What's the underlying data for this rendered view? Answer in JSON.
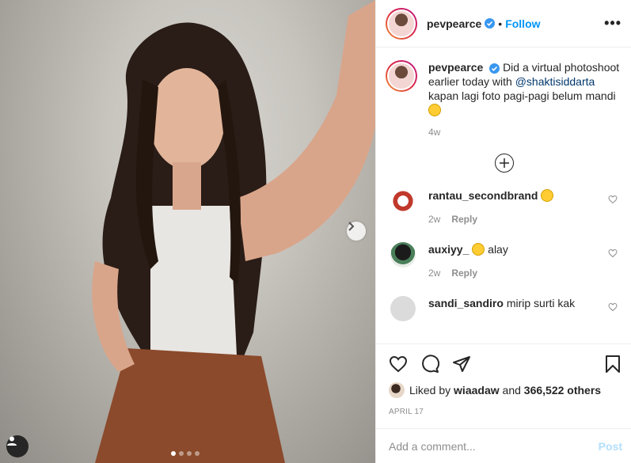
{
  "post": {
    "username": "pevpearce",
    "follow_label": "Follow",
    "separator": "•",
    "more_label": "•••",
    "caption_text": "Did a virtual photoshoot earlier today with",
    "caption_mention": "@shaktisiddarta",
    "caption_text_2": "kapan lagi foto pagi-pagi belum mandi",
    "caption_time": "4w",
    "carousel": {
      "count": 4,
      "active_index": 0
    }
  },
  "comments": [
    {
      "username": "rantau_secondbrand",
      "text": "",
      "emoji": "smiley-emoji",
      "time": "2w",
      "reply_label": "Reply"
    },
    {
      "username": "auxiyy_",
      "text": "alay",
      "emoji": "grinning-sweat-emoji",
      "time": "2w",
      "reply_label": "Reply"
    },
    {
      "username": "sandi_sandiro",
      "text": "mirip surti kak",
      "emoji": "",
      "time": "",
      "reply_label": ""
    }
  ],
  "likes": {
    "prefix": "Liked by",
    "liker": "wiaadaw",
    "conjunction": "and",
    "others": "366,522 others"
  },
  "date": "APRIL 17",
  "add_comment": {
    "placeholder": "Add a comment...",
    "post_label": "Post"
  },
  "colors": {
    "accent": "#0095f6",
    "post_disabled": "#b2dffc",
    "muted": "#8e8e8e",
    "text": "#262626"
  }
}
